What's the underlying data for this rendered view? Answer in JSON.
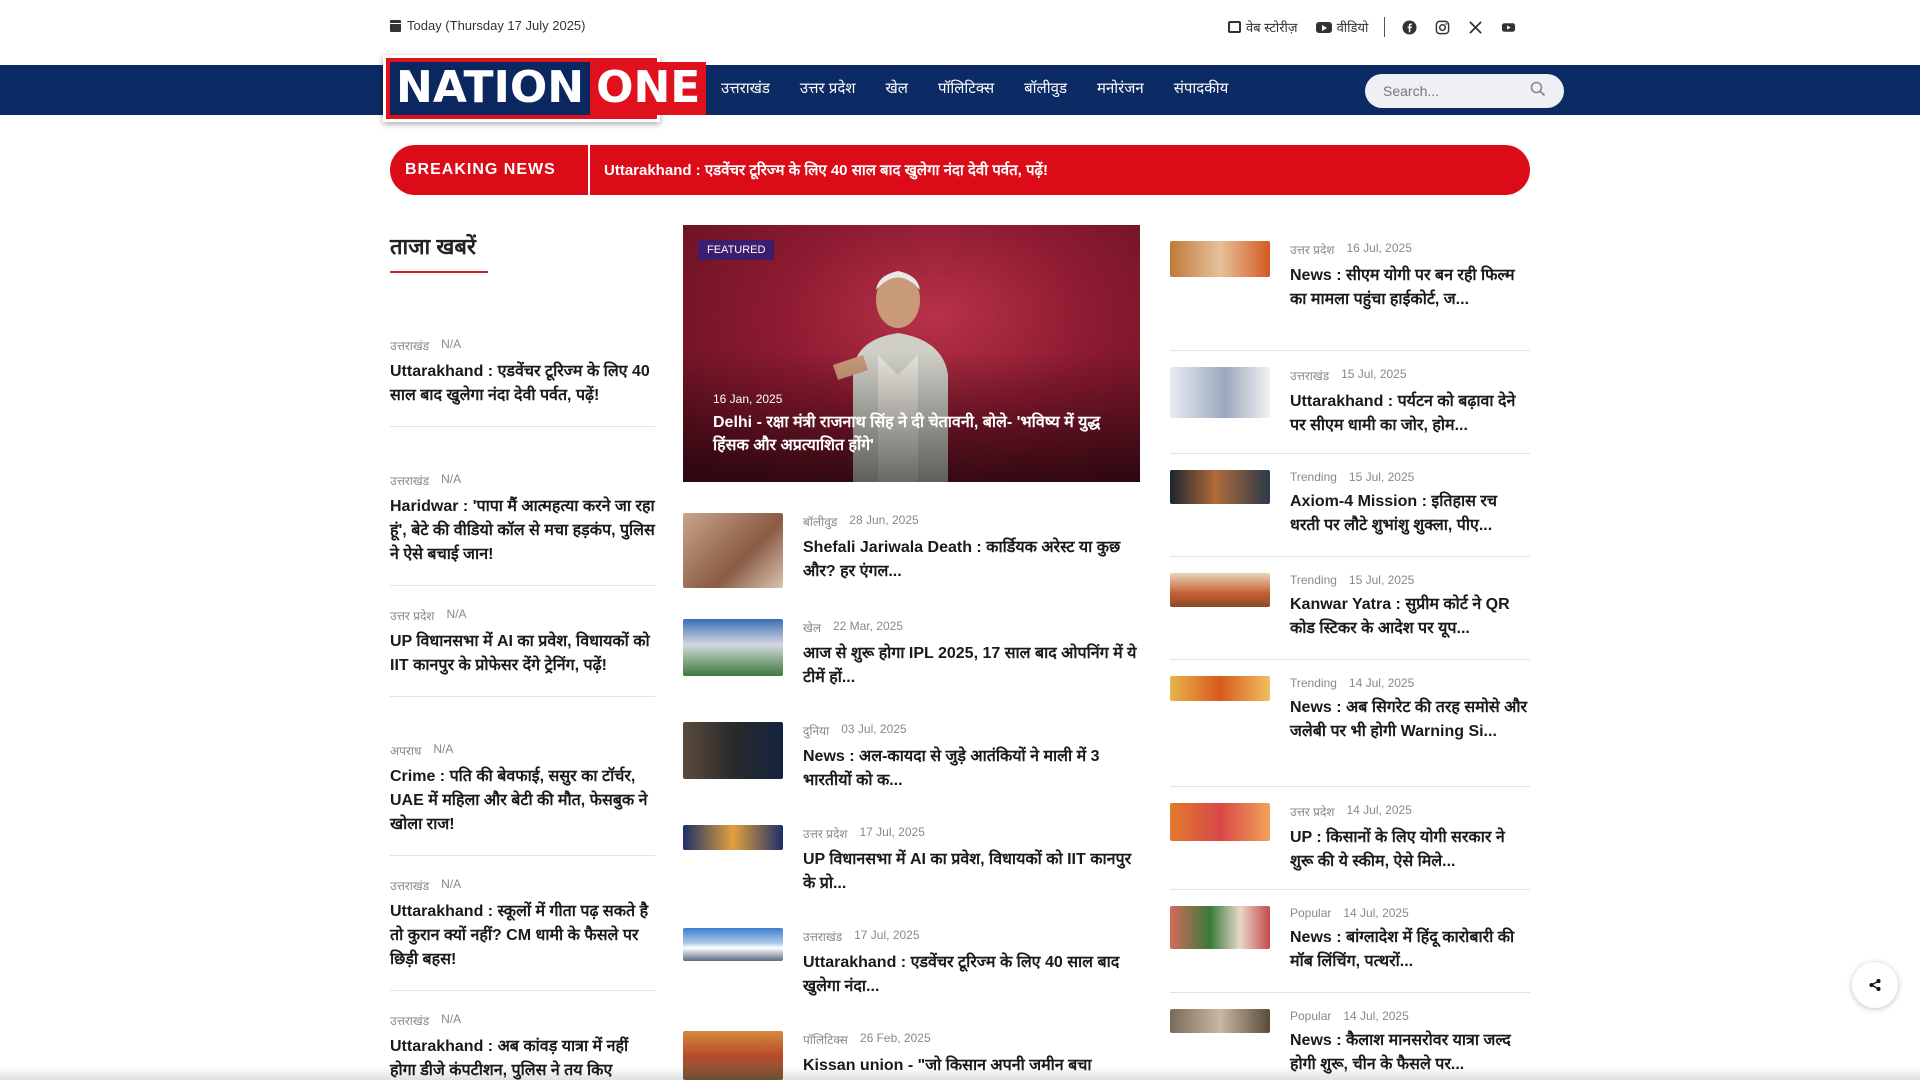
{
  "header": {
    "date": "Today (Thursday 17 July 2025)",
    "links": {
      "web_stories": "वेब स्टोरीज़",
      "video": "वीडियो"
    },
    "social_icons": [
      "facebook-icon",
      "instagram-icon",
      "x-icon",
      "youtube-icon"
    ]
  },
  "logo": {
    "part1": "NATION",
    "part2": "ONE"
  },
  "nav": {
    "items": [
      "उत्तराखंड",
      "उत्तर प्रदेश",
      "खेल",
      "पॉलिटिक्स",
      "बॉलीवुड",
      "मनोरंजन",
      "संपादकीय"
    ]
  },
  "search": {
    "placeholder": "Search..."
  },
  "breaking": {
    "label": "BREAKING NEWS",
    "text": "Uttarakhand : एडवेंचर टूरिज्म के लिए 40 साल बाद खुलेगा नंदा देवी पर्वत, पढ़ें!"
  },
  "latest": {
    "title": "ताजा खबरें",
    "items": [
      {
        "category": "उत्तराखंड",
        "date": "N/A",
        "title": "Uttarakhand : एडवेंचर टूरिज्म के लिए 40 साल बाद खुलेगा नंदा देवी पर्वत, पढ़ें!"
      },
      {
        "category": "उत्तराखंड",
        "date": "N/A",
        "title": "Haridwar : 'पापा मैं आत्महत्या करने जा रहा हूं', बेटे की वीडियो कॉल से मचा हड़कंप, पुलिस ने ऐसे बचाई जान!"
      },
      {
        "category": "उत्तर प्रदेश",
        "date": "N/A",
        "title": "UP विधानसभा में AI का प्रवेश, विधायकों को IIT कानपुर के प्रोफेसर देंगे ट्रेनिंग, पढ़ें!"
      },
      {
        "category": "अपराध",
        "date": "N/A",
        "title": "Crime : पति की बेवफाई, ससुर का टॉर्चर, UAE में महिला और बेटी की मौत, फेसबुक ने खोला राज!"
      },
      {
        "category": "उत्तराखंड",
        "date": "N/A",
        "title": "Uttarakhand : स्कूलों में गीता पढ़ सकते है तो कुरान क्यों नहीं? CM धामी के फैसले पर छिड़ी बहस!"
      },
      {
        "category": "उत्तराखंड",
        "date": "N/A",
        "title": "Uttarakhand : अब कांवड़ यात्रा में नहीं होगा डीजे कंपटीशन, पुलिस ने तय किए"
      }
    ]
  },
  "featured": {
    "tag": "FEATURED",
    "date": "16 Jan, 2025",
    "title": "Delhi - रक्षा मंत्री राजनाथ सिंह ने दी चेतावनी, बोले- 'भविष्य में युद्ध हिंसक और अप्रत्याशित होंगे'"
  },
  "center_news": [
    {
      "category": "बॉलीवुड",
      "date": "28 Jun, 2025",
      "title": "Shefali Jariwala Death : कार्डियक अरेस्ट या कुछ और? हर एंगल..."
    },
    {
      "category": "खेल",
      "date": "22 Mar, 2025",
      "title": "आज से शुरू होगा IPL 2025, 17 साल बाद ओपनिंग में ये टीमें हों..."
    },
    {
      "category": "दुनिया",
      "date": "03 Jul, 2025",
      "title": "News : अल-कायदा से जुड़े आतंकियों ने माली में 3 भारतीयों को क..."
    },
    {
      "category": "उत्तर प्रदेश",
      "date": "17 Jul, 2025",
      "title": "UP विधानसभा में AI का प्रवेश, विधायकों को IIT कानपुर के प्रो..."
    },
    {
      "category": "उत्तराखंड",
      "date": "17 Jul, 2025",
      "title": "Uttarakhand : एडवेंचर टूरिज्म के लिए 40 साल बाद खुलेगा नंदा..."
    },
    {
      "category": "पॉलिटिक्स",
      "date": "26 Feb, 2025",
      "title": "Kissan union - \"जो किसान अपनी जमीन बचा"
    }
  ],
  "right_news": [
    {
      "category": "उत्तर प्रदेश",
      "date": "16 Jul, 2025",
      "title": "News : सीएम योगी पर बन रही फिल्म का मामला पहुंचा हाईकोर्ट, ज..."
    },
    {
      "category": "उत्तराखंड",
      "date": "15 Jul, 2025",
      "title": "Uttarakhand : पर्यटन को बढ़ावा देने पर सीएम धामी का जोर, होम..."
    },
    {
      "category": "Trending",
      "date": "15 Jul, 2025",
      "title": "Axiom-4 Mission : इतिहास रच धरती पर लौटे शुभांशु शुक्ला, पीए..."
    },
    {
      "category": "Trending",
      "date": "15 Jul, 2025",
      "title": "Kanwar Yatra : सुप्रीम कोर्ट ने QR कोड स्टिकर के आदेश पर यूप..."
    },
    {
      "category": "Trending",
      "date": "14 Jul, 2025",
      "title": "News : अब सिगरेट की तरह समोसे और जलेबी पर भी होगी Warning Si..."
    },
    {
      "category": "उत्तर प्रदेश",
      "date": "14 Jul, 2025",
      "title": "UP : किसानों के लिए योगी सरकार ने शुरू की ये स्कीम, ऐसे मिले..."
    },
    {
      "category": "Popular",
      "date": "14 Jul, 2025",
      "title": "News : बांग्लादेश में हिंदू कारोबारी की मॉब लिंचिंग, पत्थरों..."
    },
    {
      "category": "Popular",
      "date": "14 Jul, 2025",
      "title": "News : कैलाश मानसरोवर यात्रा जल्द होगी शुरू, चीन के फैसले पर..."
    }
  ],
  "colors": {
    "nav_bg": "#0c2a63",
    "breaking_bg": "#dc0b18",
    "accent_red": "#c62828"
  }
}
